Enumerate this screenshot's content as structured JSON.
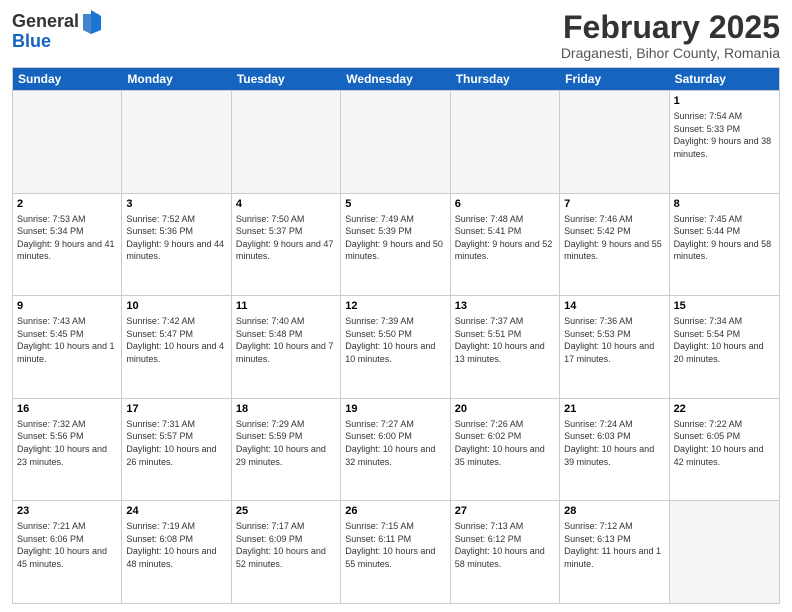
{
  "header": {
    "logo_general": "General",
    "logo_blue": "Blue",
    "month_title": "February 2025",
    "location": "Draganesti, Bihor County, Romania"
  },
  "weekdays": [
    "Sunday",
    "Monday",
    "Tuesday",
    "Wednesday",
    "Thursday",
    "Friday",
    "Saturday"
  ],
  "rows": [
    [
      {
        "day": "",
        "info": ""
      },
      {
        "day": "",
        "info": ""
      },
      {
        "day": "",
        "info": ""
      },
      {
        "day": "",
        "info": ""
      },
      {
        "day": "",
        "info": ""
      },
      {
        "day": "",
        "info": ""
      },
      {
        "day": "1",
        "info": "Sunrise: 7:54 AM\nSunset: 5:33 PM\nDaylight: 9 hours and 38 minutes."
      }
    ],
    [
      {
        "day": "2",
        "info": "Sunrise: 7:53 AM\nSunset: 5:34 PM\nDaylight: 9 hours and 41 minutes."
      },
      {
        "day": "3",
        "info": "Sunrise: 7:52 AM\nSunset: 5:36 PM\nDaylight: 9 hours and 44 minutes."
      },
      {
        "day": "4",
        "info": "Sunrise: 7:50 AM\nSunset: 5:37 PM\nDaylight: 9 hours and 47 minutes."
      },
      {
        "day": "5",
        "info": "Sunrise: 7:49 AM\nSunset: 5:39 PM\nDaylight: 9 hours and 50 minutes."
      },
      {
        "day": "6",
        "info": "Sunrise: 7:48 AM\nSunset: 5:41 PM\nDaylight: 9 hours and 52 minutes."
      },
      {
        "day": "7",
        "info": "Sunrise: 7:46 AM\nSunset: 5:42 PM\nDaylight: 9 hours and 55 minutes."
      },
      {
        "day": "8",
        "info": "Sunrise: 7:45 AM\nSunset: 5:44 PM\nDaylight: 9 hours and 58 minutes."
      }
    ],
    [
      {
        "day": "9",
        "info": "Sunrise: 7:43 AM\nSunset: 5:45 PM\nDaylight: 10 hours and 1 minute."
      },
      {
        "day": "10",
        "info": "Sunrise: 7:42 AM\nSunset: 5:47 PM\nDaylight: 10 hours and 4 minutes."
      },
      {
        "day": "11",
        "info": "Sunrise: 7:40 AM\nSunset: 5:48 PM\nDaylight: 10 hours and 7 minutes."
      },
      {
        "day": "12",
        "info": "Sunrise: 7:39 AM\nSunset: 5:50 PM\nDaylight: 10 hours and 10 minutes."
      },
      {
        "day": "13",
        "info": "Sunrise: 7:37 AM\nSunset: 5:51 PM\nDaylight: 10 hours and 13 minutes."
      },
      {
        "day": "14",
        "info": "Sunrise: 7:36 AM\nSunset: 5:53 PM\nDaylight: 10 hours and 17 minutes."
      },
      {
        "day": "15",
        "info": "Sunrise: 7:34 AM\nSunset: 5:54 PM\nDaylight: 10 hours and 20 minutes."
      }
    ],
    [
      {
        "day": "16",
        "info": "Sunrise: 7:32 AM\nSunset: 5:56 PM\nDaylight: 10 hours and 23 minutes."
      },
      {
        "day": "17",
        "info": "Sunrise: 7:31 AM\nSunset: 5:57 PM\nDaylight: 10 hours and 26 minutes."
      },
      {
        "day": "18",
        "info": "Sunrise: 7:29 AM\nSunset: 5:59 PM\nDaylight: 10 hours and 29 minutes."
      },
      {
        "day": "19",
        "info": "Sunrise: 7:27 AM\nSunset: 6:00 PM\nDaylight: 10 hours and 32 minutes."
      },
      {
        "day": "20",
        "info": "Sunrise: 7:26 AM\nSunset: 6:02 PM\nDaylight: 10 hours and 35 minutes."
      },
      {
        "day": "21",
        "info": "Sunrise: 7:24 AM\nSunset: 6:03 PM\nDaylight: 10 hours and 39 minutes."
      },
      {
        "day": "22",
        "info": "Sunrise: 7:22 AM\nSunset: 6:05 PM\nDaylight: 10 hours and 42 minutes."
      }
    ],
    [
      {
        "day": "23",
        "info": "Sunrise: 7:21 AM\nSunset: 6:06 PM\nDaylight: 10 hours and 45 minutes."
      },
      {
        "day": "24",
        "info": "Sunrise: 7:19 AM\nSunset: 6:08 PM\nDaylight: 10 hours and 48 minutes."
      },
      {
        "day": "25",
        "info": "Sunrise: 7:17 AM\nSunset: 6:09 PM\nDaylight: 10 hours and 52 minutes."
      },
      {
        "day": "26",
        "info": "Sunrise: 7:15 AM\nSunset: 6:11 PM\nDaylight: 10 hours and 55 minutes."
      },
      {
        "day": "27",
        "info": "Sunrise: 7:13 AM\nSunset: 6:12 PM\nDaylight: 10 hours and 58 minutes."
      },
      {
        "day": "28",
        "info": "Sunrise: 7:12 AM\nSunset: 6:13 PM\nDaylight: 11 hours and 1 minute."
      },
      {
        "day": "",
        "info": ""
      }
    ]
  ]
}
